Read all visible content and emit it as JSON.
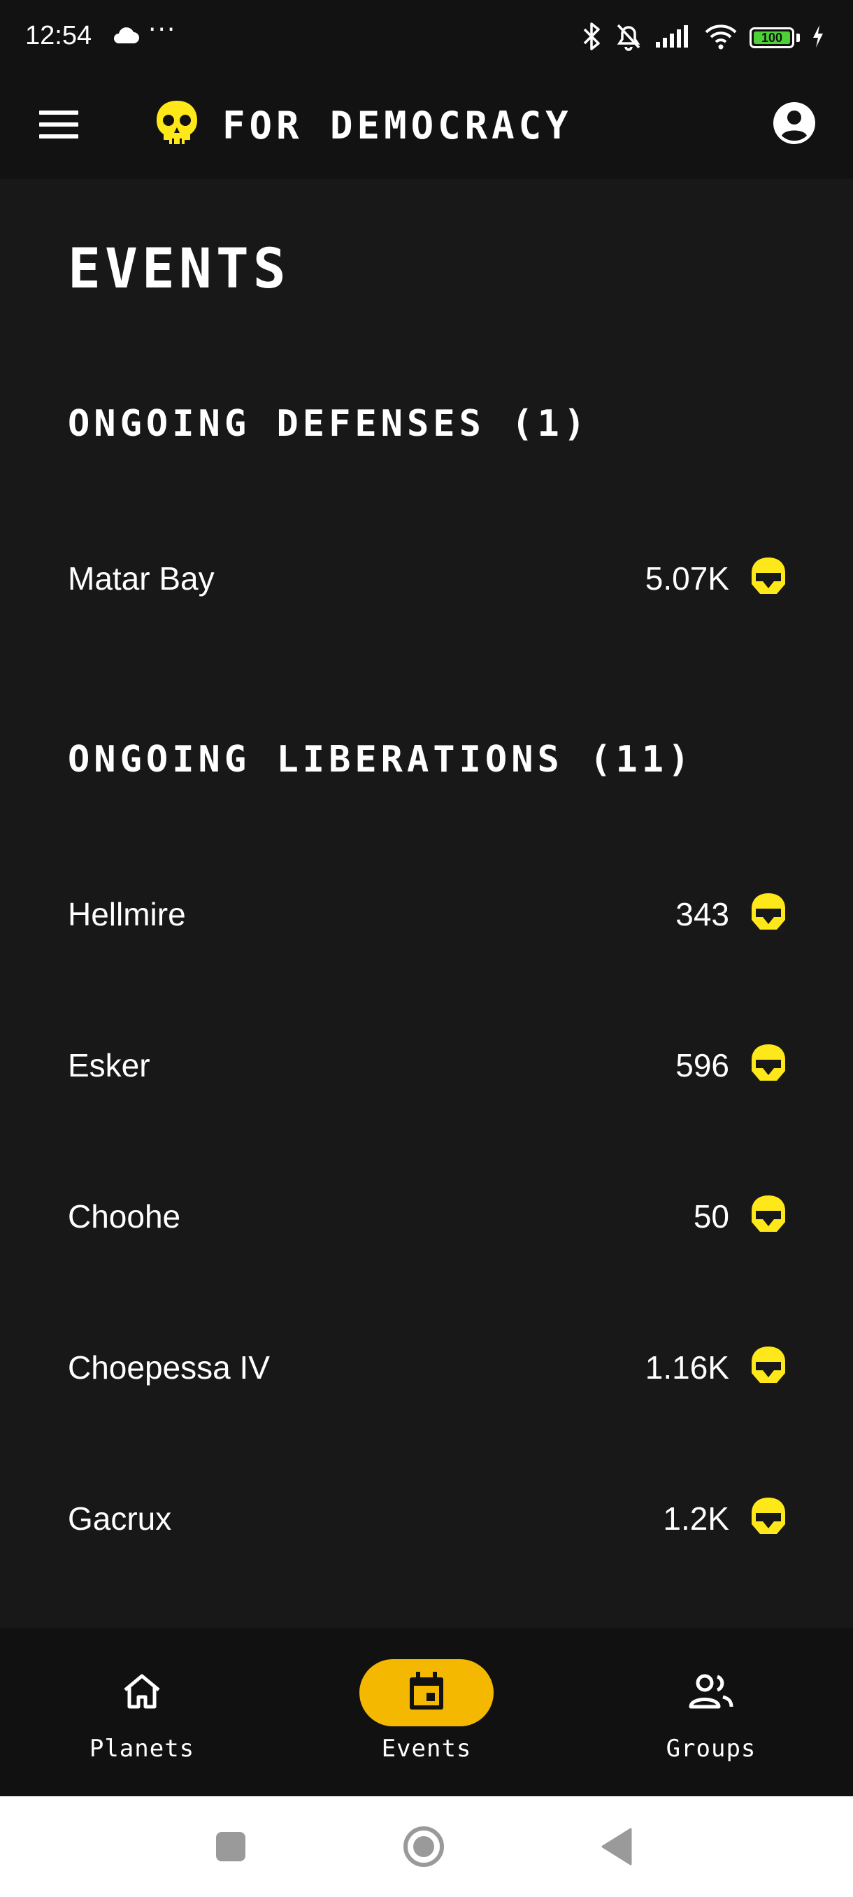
{
  "status_bar": {
    "time": "12:54",
    "more": "···",
    "battery": "100",
    "battery_color": "#4cd137"
  },
  "app_bar": {
    "title": "FOR DEMOCRACY",
    "logo_icon": "skull-icon",
    "menu_icon": "hamburger-menu-icon",
    "account_icon": "account-circle-icon",
    "accent_color": "#ffe81a"
  },
  "page": {
    "title": "EVENTS"
  },
  "defenses": {
    "title": "ONGOING DEFENSES (1)",
    "items": [
      {
        "name": "Matar Bay",
        "count": "5.07K"
      }
    ]
  },
  "liberations": {
    "title": "ONGOING LIBERATIONS (11)",
    "items": [
      {
        "name": "Hellmire",
        "count": "343"
      },
      {
        "name": "Esker",
        "count": "596"
      },
      {
        "name": "Choohe",
        "count": "50"
      },
      {
        "name": "Choepessa IV",
        "count": "1.16K"
      },
      {
        "name": "Gacrux",
        "count": "1.2K"
      }
    ]
  },
  "bottom_nav": {
    "active_color": "#f5b800",
    "items": [
      {
        "label": "Planets",
        "icon": "home-icon",
        "active": false
      },
      {
        "label": "Events",
        "icon": "calendar-icon",
        "active": true
      },
      {
        "label": "Groups",
        "icon": "people-icon",
        "active": false
      }
    ]
  },
  "system_nav": {
    "items": [
      "recents-square-icon",
      "home-circle-icon",
      "back-triangle-icon"
    ]
  }
}
